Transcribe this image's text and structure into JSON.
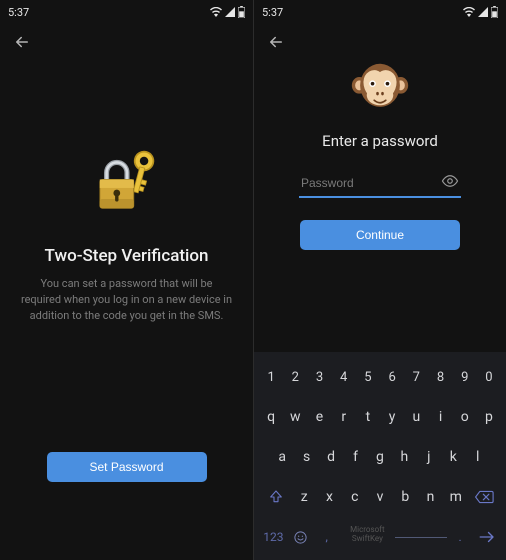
{
  "colors": {
    "accent": "#4a8fe0",
    "accent_dark": "#3a79c6"
  },
  "status": {
    "time": "5:37"
  },
  "screen1": {
    "title": "Two-Step Verification",
    "description": "You can set a password that will be required when you log in on a new device in addition to the code you get in the SMS.",
    "button": "Set Password"
  },
  "screen2": {
    "title": "Enter a password",
    "placeholder": "Password",
    "value": "",
    "button": "Continue"
  },
  "keyboard": {
    "numbers": [
      "1",
      "2",
      "3",
      "4",
      "5",
      "6",
      "7",
      "8",
      "9",
      "0"
    ],
    "row1": [
      "q",
      "w",
      "e",
      "r",
      "t",
      "y",
      "u",
      "i",
      "o",
      "p"
    ],
    "row2": [
      "a",
      "s",
      "d",
      "f",
      "g",
      "h",
      "j",
      "k",
      "l"
    ],
    "row3": [
      "z",
      "x",
      "c",
      "v",
      "b",
      "n",
      "m"
    ],
    "mode_key": "123",
    "brand": "Microsoft SwiftKey"
  }
}
